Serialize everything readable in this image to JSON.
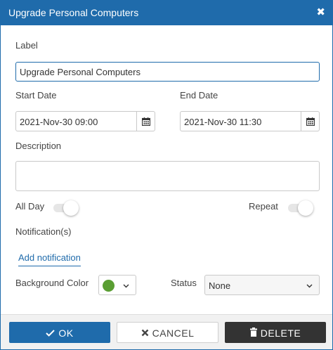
{
  "dialog": {
    "title": "Upgrade Personal Computers",
    "close_icon": "close-icon",
    "close_glyph": "✖"
  },
  "form": {
    "label_caption": "Label",
    "label_value": "Upgrade Personal Computers",
    "start_date_caption": "Start Date",
    "start_date_value": "2021-Nov-30 09:00",
    "end_date_caption": "End Date",
    "end_date_value": "2021-Nov-30 11:30",
    "calendar_icon": "calendar-icon",
    "description_caption": "Description",
    "description_value": "",
    "all_day_caption": "All Day",
    "all_day_on": false,
    "repeat_caption": "Repeat",
    "repeat_on": false,
    "notifications_caption": "Notification(s)",
    "add_notification_label": "Add notification",
    "background_color_caption": "Background Color",
    "background_color_value": "#5a9e33",
    "status_caption": "Status",
    "status_value": "None",
    "chevron_glyph": "⌄"
  },
  "footer": {
    "ok_label": "OK",
    "ok_icon": "check-icon",
    "cancel_label": "CANCEL",
    "cancel_icon": "close-icon",
    "delete_label": "DELETE",
    "delete_icon": "trash-icon"
  },
  "colors": {
    "accent": "#1f6bab",
    "delete_button": "#333333",
    "footer_bg": "#f1f1f1"
  }
}
